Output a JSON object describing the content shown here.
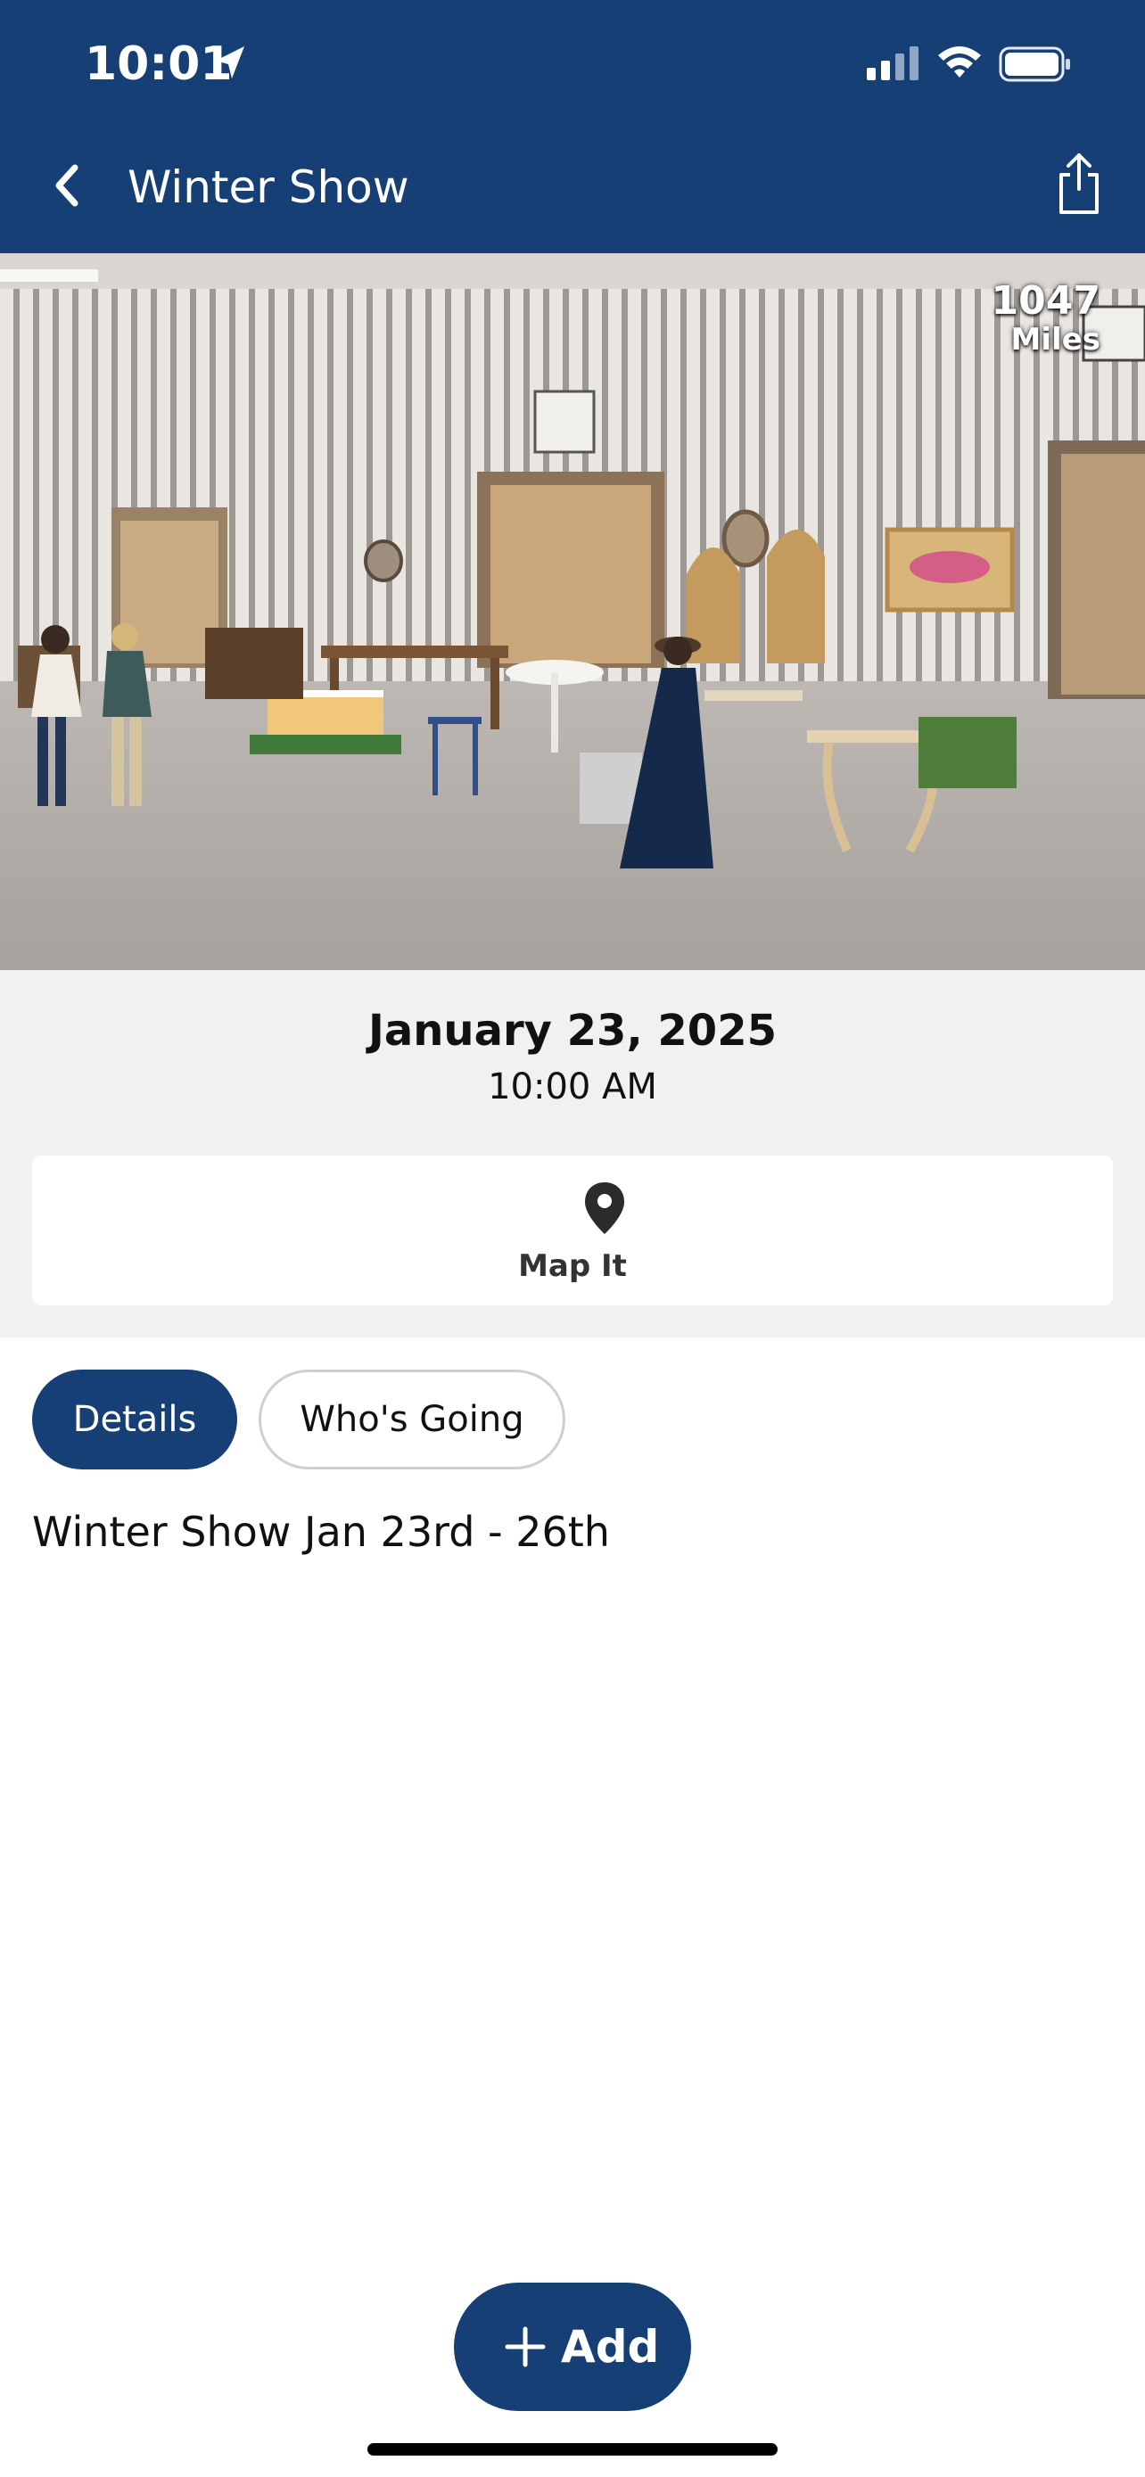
{
  "status_bar": {
    "time": "10:01"
  },
  "nav": {
    "title": "Winter Show"
  },
  "hero": {
    "distance_value": "1047",
    "distance_unit": "Miles"
  },
  "event": {
    "date": "January 23, 2025",
    "time": "10:00 AM",
    "map_label": "Map It"
  },
  "tabs": [
    {
      "label": "Details",
      "active": true
    },
    {
      "label": "Who's Going",
      "active": false
    }
  ],
  "description": "Winter Show Jan 23rd - 26th",
  "add_button": {
    "label": "Add"
  },
  "colors": {
    "brand": "#163f75",
    "info_background": "#f0f1f3"
  },
  "icons": {
    "back": "chevron-left-icon",
    "share": "share-icon",
    "map": "map-pin-icon",
    "add": "plus-icon"
  }
}
